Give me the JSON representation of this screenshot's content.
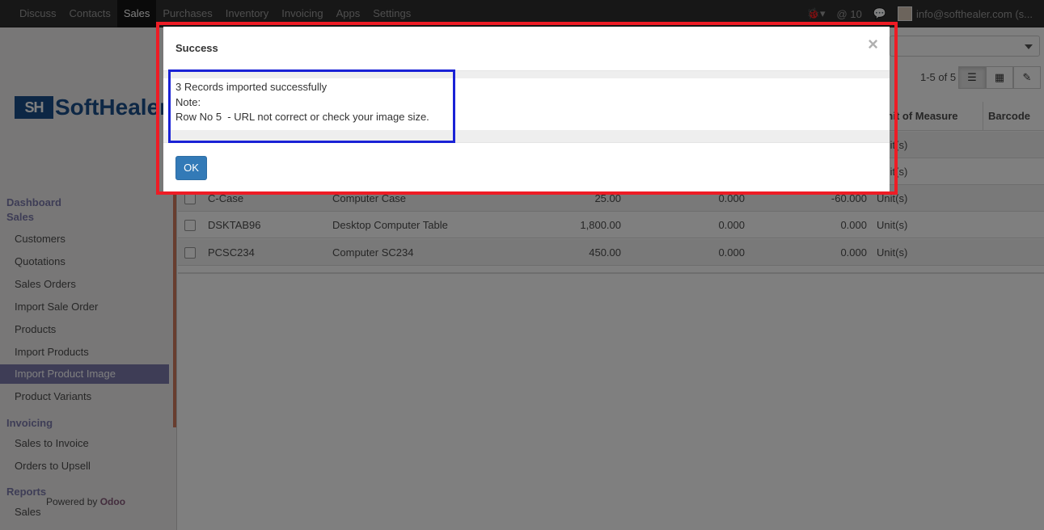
{
  "topbar": {
    "menu": [
      "Discuss",
      "Contacts",
      "Sales",
      "Purchases",
      "Inventory",
      "Invoicing",
      "Apps",
      "Settings"
    ],
    "active": "Sales",
    "bug_icon": "bug-icon",
    "mentions": "@ 10",
    "chat_icon": "chat-icon",
    "user": "info@softhealer.com (s..."
  },
  "sidebar": {
    "logo_mark": "SH",
    "logo_text": "SoftHealer",
    "dashboard": "Dashboard",
    "sales_title": "Sales",
    "sales_items": [
      "Customers",
      "Quotations",
      "Sales Orders",
      "Import Sale Order",
      "Products",
      "Import Products",
      "Import Product Image",
      "Product Variants"
    ],
    "active_item": "Import Product Image",
    "invoicing_title": "Invoicing",
    "invoicing_items": [
      "Sales to Invoice",
      "Orders to Upsell"
    ],
    "reports_title": "Reports",
    "reports_items": [
      "Sales"
    ],
    "powered_prefix": "Powered by",
    "powered_brand": "Odoo"
  },
  "list": {
    "pager": "1-5 of 5",
    "headers": {
      "uom": "Unit of Measure",
      "barcode": "Barcode"
    },
    "rows": [
      {
        "ref": "",
        "name": "",
        "price": "",
        "cost": "",
        "qty": "",
        "uom": "Unit(s)"
      },
      {
        "ref": "",
        "name": "",
        "price": "",
        "cost": "",
        "qty": "",
        "uom": "Unit(s)"
      },
      {
        "ref": "C-Case",
        "name": "Computer Case",
        "price": "25.00",
        "cost": "0.000",
        "qty": "-60.000",
        "uom": "Unit(s)"
      },
      {
        "ref": "DSKTAB96",
        "name": "Desktop Computer Table",
        "price": "1,800.00",
        "cost": "0.000",
        "qty": "0.000",
        "uom": "Unit(s)"
      },
      {
        "ref": "PCSC234",
        "name": "Computer SC234",
        "price": "450.00",
        "cost": "0.000",
        "qty": "0.000",
        "uom": "Unit(s)"
      }
    ]
  },
  "modal": {
    "title": "Success",
    "close": "×",
    "line1": "3 Records imported successfully",
    "line2": "Note:",
    "line3": "Row No 5  - URL not correct or check your image size.",
    "ok": "OK"
  }
}
